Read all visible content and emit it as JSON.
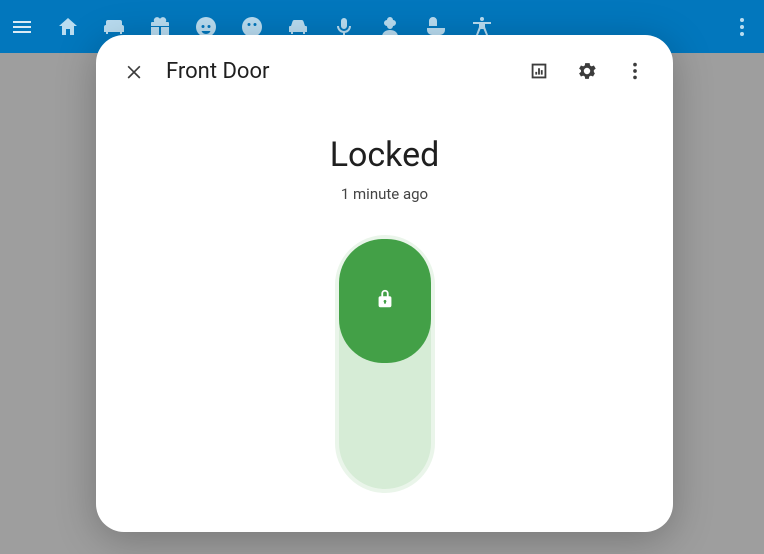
{
  "topbar": {
    "icons": [
      "menu-icon",
      "house-icon",
      "couch-icon",
      "gift-icon",
      "face-mask-icon",
      "face-icon",
      "car-icon",
      "mic-icon",
      "flower-icon",
      "bath-icon",
      "accessibility-icon"
    ],
    "more_icon": "more-vert-icon"
  },
  "dialog": {
    "title": "Front Door",
    "close_icon": "close-icon",
    "header_icons": [
      "history-chart-icon",
      "settings-icon",
      "more-vert-icon"
    ],
    "status_title": "Locked",
    "status_sub": "1 minute ago",
    "lock_state": "locked",
    "lock_icon": "lock-icon",
    "colors": {
      "knob": "#43a047",
      "track": "#d6ecd6",
      "track_border": "#eaf5ea"
    }
  }
}
